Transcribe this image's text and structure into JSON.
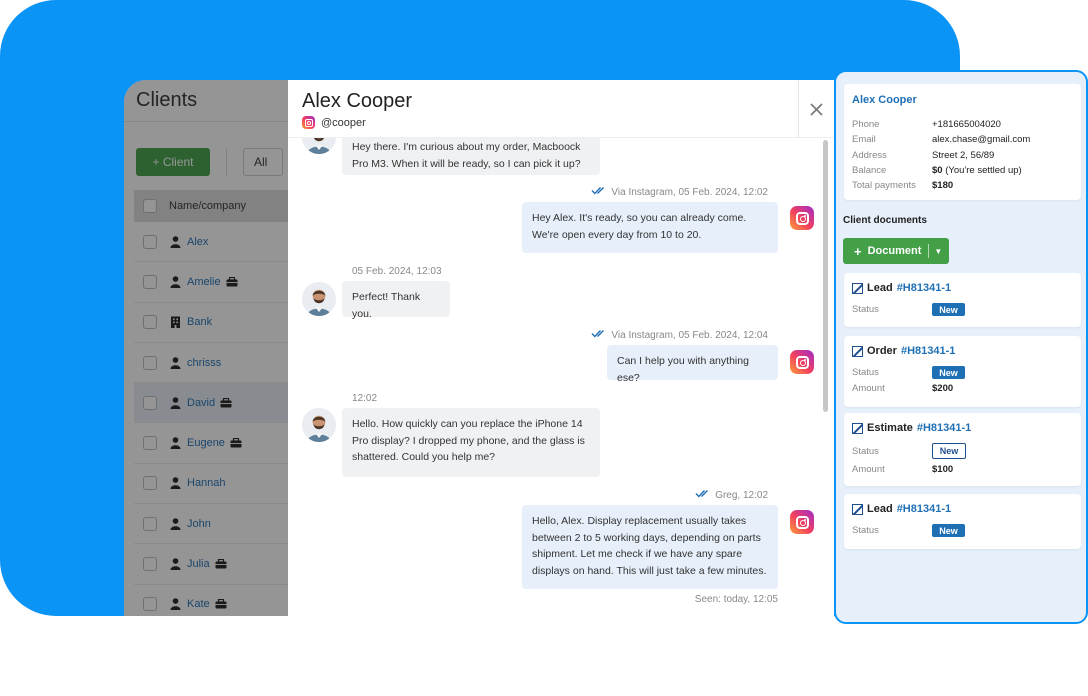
{
  "clients": {
    "title": "Clients",
    "add_label": "+ Client",
    "filter": "All",
    "column_name": "Name/company",
    "rows": [
      {
        "name": "Alex",
        "type": "person",
        "brief": false
      },
      {
        "name": "Amelie",
        "type": "person",
        "brief": true
      },
      {
        "name": "Bank",
        "type": "company",
        "brief": false
      },
      {
        "name": "chrisss",
        "type": "person",
        "brief": false
      },
      {
        "name": "David",
        "type": "person",
        "brief": true
      },
      {
        "name": "Eugene",
        "type": "person",
        "brief": true
      },
      {
        "name": "Hannah",
        "type": "person",
        "brief": false
      },
      {
        "name": "John",
        "type": "person",
        "brief": false
      },
      {
        "name": "Julia",
        "type": "person",
        "brief": true
      },
      {
        "name": "Kate",
        "type": "person",
        "brief": true
      }
    ]
  },
  "chat": {
    "name": "Alex Cooper",
    "handle": "@cooper",
    "messages": [
      {
        "id": "m1",
        "dir": "in",
        "text": "Hey there. I'm curious about my order, Macboock Pro M3. When it will be ready, so I can pick it up?"
      },
      {
        "id": "m2",
        "dir": "out",
        "meta": "Via Instagram, 05 Feb. 2024, 12:02",
        "text": "Hey Alex. It's ready, so you can already come. We're open every day from 10 to 20."
      },
      {
        "id": "m3",
        "dir": "in",
        "meta": "05 Feb. 2024, 12:03",
        "text": "Perfect! Thank you."
      },
      {
        "id": "m4",
        "dir": "out",
        "meta": "Via Instagram, 05 Feb. 2024, 12:04",
        "text": "Can I help you with anything ese?"
      },
      {
        "id": "m5",
        "dir": "in",
        "meta": "12:02",
        "text": "Hello. How quickly can you replace the iPhone 14 Pro display? I dropped my phone, and the glass is shattered. Could you help me?"
      },
      {
        "id": "m6",
        "dir": "out",
        "meta": "Greg, 12:02",
        "text": "Hello, Alex. Display replacement usually takes between 2 to 5 working days, depending on parts shipment. Let me check if we have any spare displays on hand. This will just take a few minutes."
      }
    ],
    "seen": "Seen: today, 12:05"
  },
  "client_card": {
    "name": "Alex Cooper",
    "fields": [
      {
        "label": "Phone",
        "value": "+181665004020",
        "bold": ""
      },
      {
        "label": "Email",
        "value": "alex.chase@gmail.com",
        "bold": ""
      },
      {
        "label": "Address",
        "value": "Street 2, 56/89",
        "bold": ""
      },
      {
        "label": "Balance",
        "bold": "$0",
        "value": " (You're settled up)"
      },
      {
        "label": "Total payments",
        "bold": "$180",
        "value": ""
      }
    ]
  },
  "documents": {
    "title": "Client documents",
    "button_label": "Document",
    "items": [
      {
        "type": "Lead",
        "number": "#H81341-1",
        "status_label": "Status",
        "status": "New",
        "status_style": "filled"
      },
      {
        "type": "Order",
        "number": "#H81341-1",
        "status_label": "Status",
        "status": "New",
        "status_style": "filled",
        "amount_label": "Amount",
        "amount": "$200"
      },
      {
        "type": "Estimate",
        "number": "#H81341-1",
        "status_label": "Status",
        "status": "New",
        "status_style": "outline",
        "amount_label": "Amount",
        "amount": "$100"
      },
      {
        "type": "Lead",
        "number": "#H81341-1",
        "status_label": "Status",
        "status": "New",
        "status_style": "filled"
      }
    ]
  },
  "colors": {
    "brand_blue": "#0a94f5",
    "green": "#43a047",
    "link": "#1f6fb5"
  }
}
